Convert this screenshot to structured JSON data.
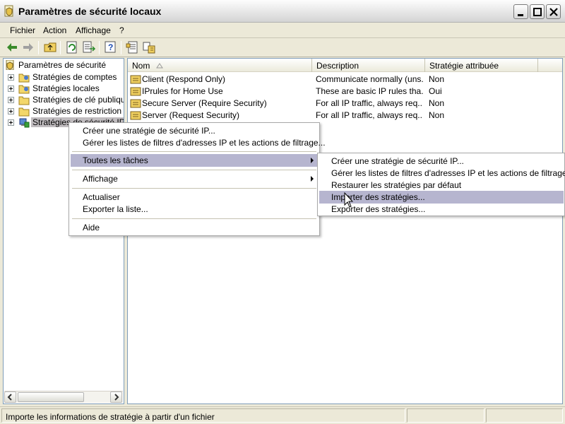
{
  "window": {
    "title": "Paramètres de sécurité locaux"
  },
  "menu": {
    "items": [
      {
        "label": "Fichier"
      },
      {
        "label": "Action"
      },
      {
        "label": "Affichage"
      },
      {
        "label": "?"
      }
    ]
  },
  "tree": {
    "root": "Paramètres de sécurité",
    "items": [
      {
        "label": "Stratégies de comptes",
        "icon": "folder-icon"
      },
      {
        "label": "Stratégies locales",
        "icon": "folder-icon"
      },
      {
        "label": "Stratégies de clé publique",
        "icon": "folder-icon"
      },
      {
        "label": "Stratégies de restriction logicielle",
        "icon": "folder-icon"
      },
      {
        "label": "Stratégies de sécurité IP sur l'ordinateur local",
        "icon": "ip-security-icon"
      }
    ]
  },
  "list": {
    "columns": [
      "Nom",
      "Description",
      "Stratégie attribuée"
    ],
    "rows": [
      {
        "name": "Client (Respond Only)",
        "description": "Communicate normally (uns...",
        "assigned": "Non"
      },
      {
        "name": "IPrules for Home Use",
        "description": "These are basic IP rules tha...",
        "assigned": "Oui"
      },
      {
        "name": "Secure Server (Require Security)",
        "description": "For all IP traffic, always req...",
        "assigned": "Non"
      },
      {
        "name": "Server (Request Security)",
        "description": "For all IP traffic, always req...",
        "assigned": "Non"
      }
    ]
  },
  "context_menu": {
    "items": [
      {
        "label": "Créer une stratégie de sécurité IP..."
      },
      {
        "label": "Gérer les listes de filtres d'adresses IP et les actions de filtrage..."
      },
      {
        "label": "Toutes les tâches"
      },
      {
        "label": "Affichage"
      },
      {
        "label": "Actualiser"
      },
      {
        "label": "Exporter la liste..."
      },
      {
        "label": "Aide"
      }
    ]
  },
  "submenu": {
    "items": [
      {
        "label": "Créer une stratégie de sécurité IP..."
      },
      {
        "label": "Gérer les listes de filtres d'adresses IP et les actions de filtrage..."
      },
      {
        "label": "Restaurer les stratégies par défaut"
      },
      {
        "label": "Importer des stratégies..."
      },
      {
        "label": "Exporter des stratégies..."
      }
    ]
  },
  "status": {
    "text": "Importe les informations de stratégie à partir d'un fichier"
  },
  "colors": {
    "selection": "#c0bcbf",
    "menu_highlight": "#b6b5cf",
    "pane_border": "#7f9db9"
  }
}
